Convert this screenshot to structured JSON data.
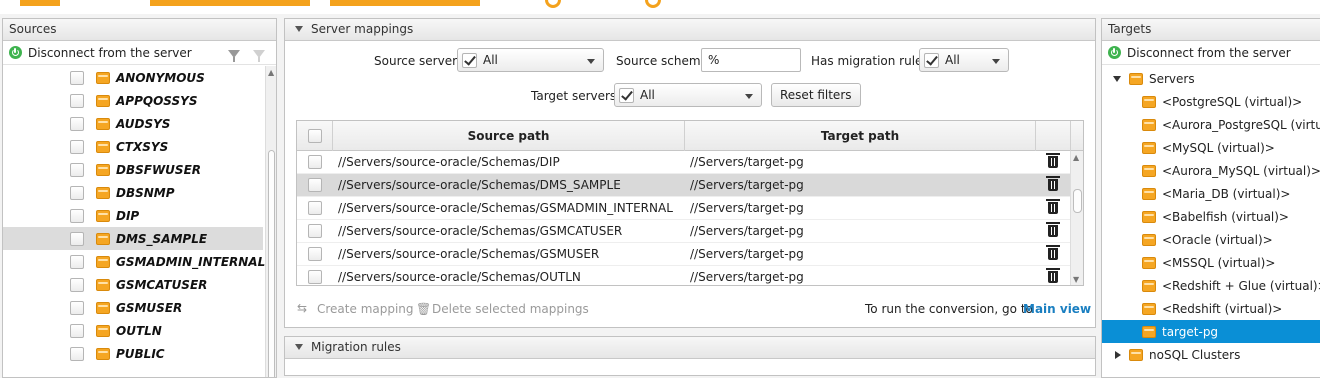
{
  "colors": {
    "accent": "#f4a21d",
    "selection": "#0a8fd6",
    "link": "#1a7fc1",
    "ok": "#3fb34f"
  },
  "sources": {
    "title": "Sources",
    "disconnect_label": "Disconnect from the server",
    "items": [
      {
        "label": "ANONYMOUS",
        "selected": false
      },
      {
        "label": "APPQOSSYS",
        "selected": false
      },
      {
        "label": "AUDSYS",
        "selected": false
      },
      {
        "label": "CTXSYS",
        "selected": false
      },
      {
        "label": "DBSFWUSER",
        "selected": false
      },
      {
        "label": "DBSNMP",
        "selected": false
      },
      {
        "label": "DIP",
        "selected": false
      },
      {
        "label": "DMS_SAMPLE",
        "selected": true
      },
      {
        "label": "GSMADMIN_INTERNAL",
        "selected": false
      },
      {
        "label": "GSMCATUSER",
        "selected": false
      },
      {
        "label": "GSMUSER",
        "selected": false
      },
      {
        "label": "OUTLN",
        "selected": false
      },
      {
        "label": "PUBLIC",
        "selected": false
      }
    ]
  },
  "mappings": {
    "title": "Server mappings",
    "filters": {
      "source_servers_label": "Source servers",
      "source_servers_value": "All",
      "source_schema_label": "Source schema",
      "source_schema_value": "%",
      "has_rules_label": "Has migration rules",
      "has_rules_value": "All",
      "target_servers_label": "Target servers",
      "target_servers_value": "All",
      "reset_label": "Reset filters"
    },
    "columns": {
      "source": "Source path",
      "target": "Target path"
    },
    "rows": [
      {
        "source": "//Servers/source-oracle/Schemas/DIP",
        "target": "//Servers/target-pg",
        "selected": false
      },
      {
        "source": "//Servers/source-oracle/Schemas/DMS_SAMPLE",
        "target": "//Servers/target-pg",
        "selected": true
      },
      {
        "source": "//Servers/source-oracle/Schemas/GSMADMIN_INTERNAL",
        "target": "//Servers/target-pg",
        "selected": false
      },
      {
        "source": "//Servers/source-oracle/Schemas/GSMCATUSER",
        "target": "//Servers/target-pg",
        "selected": false
      },
      {
        "source": "//Servers/source-oracle/Schemas/GSMUSER",
        "target": "//Servers/target-pg",
        "selected": false
      },
      {
        "source": "//Servers/source-oracle/Schemas/OUTLN",
        "target": "//Servers/target-pg",
        "selected": false
      }
    ],
    "create_mapping_label": "Create mapping",
    "delete_selected_label": "Delete selected mappings",
    "run_hint": "To run the conversion, go to",
    "main_view_link": "Main view"
  },
  "rules": {
    "title": "Migration rules"
  },
  "targets": {
    "title": "Targets",
    "disconnect_label": "Disconnect from the server",
    "servers_label": "Servers",
    "items": [
      {
        "label": "<PostgreSQL (virtual)>",
        "selected": false
      },
      {
        "label": "<Aurora_PostgreSQL (virtual)>",
        "selected": false
      },
      {
        "label": "<MySQL (virtual)>",
        "selected": false
      },
      {
        "label": "<Aurora_MySQL (virtual)>",
        "selected": false
      },
      {
        "label": "<Maria_DB (virtual)>",
        "selected": false
      },
      {
        "label": "<Babelfish (virtual)>",
        "selected": false
      },
      {
        "label": "<Oracle (virtual)>",
        "selected": false
      },
      {
        "label": "<MSSQL (virtual)>",
        "selected": false
      },
      {
        "label": "<Redshift + Glue (virtual)>",
        "selected": false
      },
      {
        "label": "<Redshift (virtual)>",
        "selected": false
      },
      {
        "label": "target-pg",
        "selected": true
      }
    ],
    "nosql_label": "noSQL Clusters"
  }
}
